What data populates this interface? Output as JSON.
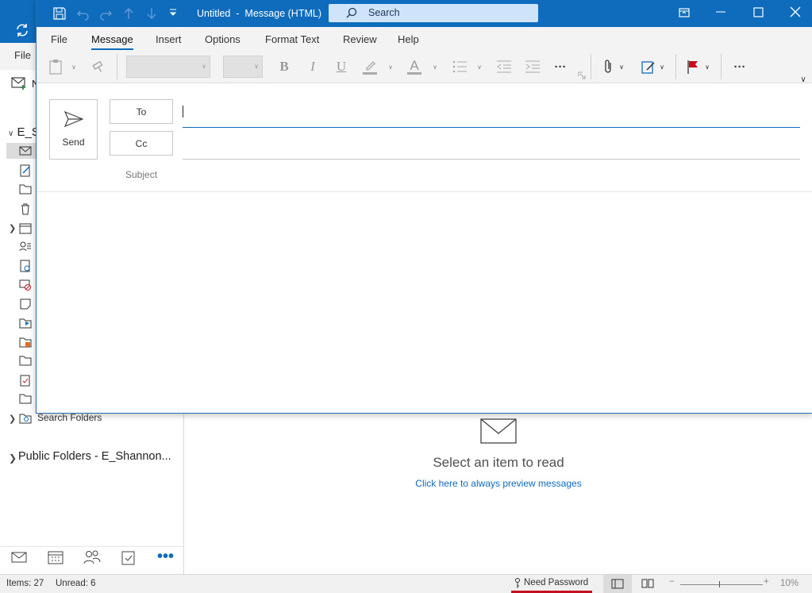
{
  "main": {
    "menu": {
      "file": "File",
      "new_initial": "N"
    },
    "account_initial": "E_S",
    "search_folders": "Search Folders",
    "public_folders": "Public Folders - E_Shannon...",
    "reading_pane": {
      "select_text": "Select an item to read",
      "preview_link": "Click here to always preview messages"
    },
    "status": {
      "items": "Items: 27",
      "unread": "Unread: 6",
      "need_password": "Need Password",
      "zoom_minus": "−",
      "zoom_plus": "+",
      "zoom": "10%"
    }
  },
  "compose": {
    "title": "Untitled  -  Message (HTML)",
    "search_placeholder": "Search",
    "tabs": [
      "File",
      "Message",
      "Insert",
      "Options",
      "Format Text",
      "Review",
      "Help"
    ],
    "active_tab": "Message",
    "ribbon": {
      "bold": "B",
      "italic": "I",
      "underline": "U",
      "font_color": "A",
      "more": "···"
    },
    "send_label": "Send",
    "to_label": "To",
    "cc_label": "Cc",
    "subject_label": "Subject",
    "to_value": "",
    "cc_value": "",
    "subject_value": ""
  },
  "colors": {
    "accent": "#0f6cbd",
    "need_password_underline": "#c50f1f",
    "flag": "#c50f1f"
  }
}
